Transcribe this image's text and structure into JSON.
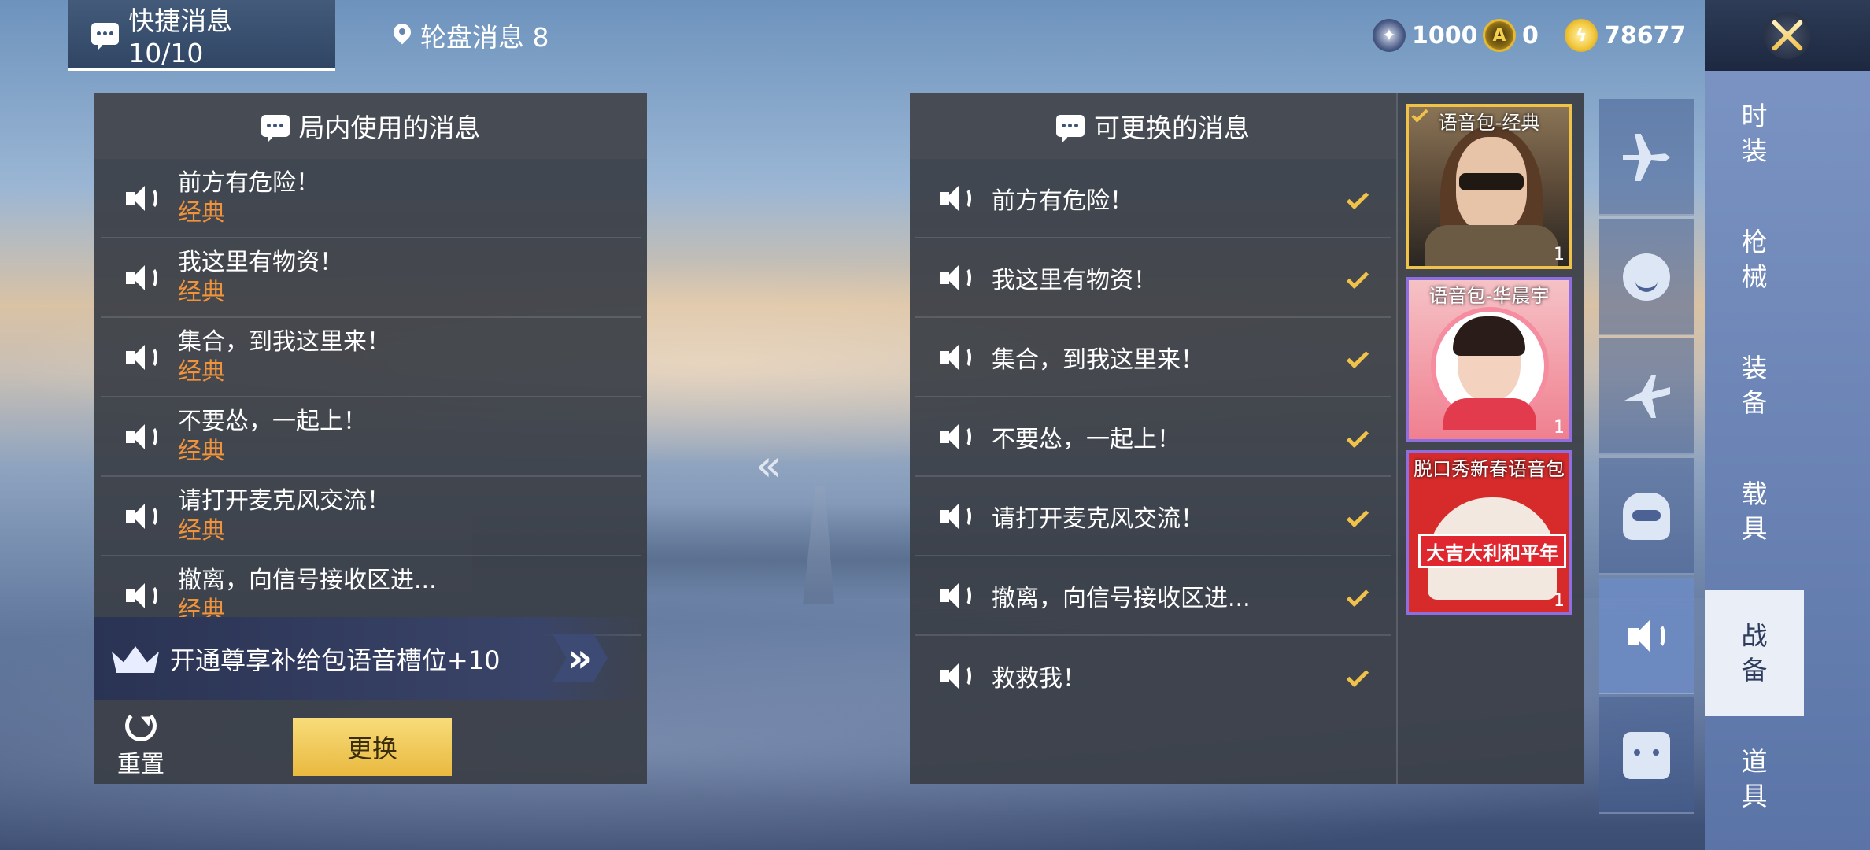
{
  "tabs": [
    {
      "label": "快捷消息 10/10",
      "active": true
    },
    {
      "label": "轮盘消息 8",
      "active": false
    }
  ],
  "currencies": [
    {
      "value": "1000",
      "icon": "silver-coin-icon"
    },
    {
      "value": "0",
      "icon": "gold-token-icon"
    },
    {
      "value": "78677",
      "icon": "gold-coin-icon"
    }
  ],
  "left_panel": {
    "title": "局内使用的消息",
    "messages": [
      {
        "text": "前方有危险！",
        "pack": "经典"
      },
      {
        "text": "我这里有物资！",
        "pack": "经典"
      },
      {
        "text": "集合，到我这里来！",
        "pack": "经典"
      },
      {
        "text": "不要怂，一起上！",
        "pack": "经典"
      },
      {
        "text": "请打开麦克风交流！",
        "pack": "经典"
      },
      {
        "text": "撤离，向信号接收区进...",
        "pack": "经典"
      }
    ],
    "promo_text": "开通尊享补给包语音槽位+10",
    "reset_label": "重置",
    "replace_label": "更换"
  },
  "middle_arrow": "«",
  "right_panel": {
    "title": "可更换的消息",
    "messages": [
      {
        "text": "前方有危险！",
        "checked": true
      },
      {
        "text": "我这里有物资！",
        "checked": true
      },
      {
        "text": "集合，到我这里来！",
        "checked": true
      },
      {
        "text": "不要怂，一起上！",
        "checked": true
      },
      {
        "text": "请打开麦克风交流！",
        "checked": true
      },
      {
        "text": "撤离，向信号接收区进...",
        "checked": true
      },
      {
        "text": "救救我！",
        "checked": true
      }
    ]
  },
  "voice_packs": [
    {
      "label": "语音包-经典",
      "count": "1",
      "selected": true
    },
    {
      "label": "语音包-华晨宇",
      "count": "1",
      "selected": false
    },
    {
      "label": "脱口秀新春语音包",
      "count": "1",
      "selected": false,
      "banner": "大吉大利和平年"
    }
  ],
  "categories": [
    {
      "icon": "plane-icon",
      "active": false
    },
    {
      "icon": "emote-icon",
      "active": false
    },
    {
      "icon": "glider-icon",
      "active": false
    },
    {
      "icon": "robot-icon",
      "active": false
    },
    {
      "icon": "speaker-icon",
      "active": true
    },
    {
      "icon": "chat-icon",
      "active": false
    }
  ],
  "side_nav": [
    {
      "label": "时装",
      "active": false
    },
    {
      "label": "枪械",
      "active": false
    },
    {
      "label": "装备",
      "active": false
    },
    {
      "label": "载具",
      "active": false
    },
    {
      "label": "战备",
      "active": true
    },
    {
      "label": "道具",
      "active": false
    }
  ],
  "colors": {
    "accent_gold": "#f0c24a",
    "pack_orange": "#f0933a",
    "panel": "#3a3e46"
  }
}
